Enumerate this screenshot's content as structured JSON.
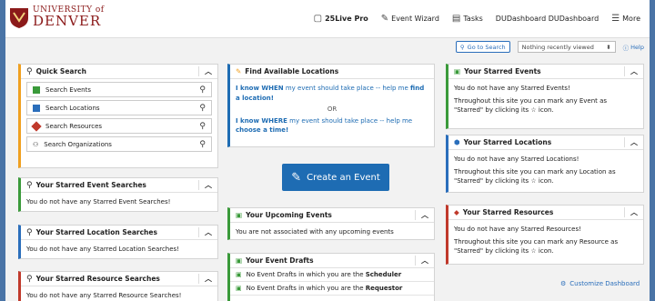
{
  "header": {
    "logo_line1": "UNIVERSITY of",
    "logo_line2": "DENVER",
    "nav": {
      "pro": "25Live Pro",
      "wizard": "Event Wizard",
      "tasks": "Tasks",
      "dashboard": "DUDashboard DUDashboard",
      "more": "More"
    }
  },
  "subbar": {
    "goto_label": "Go to Search",
    "recent_label": "Nothing recently viewed",
    "help_label": "Help"
  },
  "quick_search": {
    "title": "Quick Search",
    "items": [
      "Search Events",
      "Search Locations",
      "Search Resources",
      "Search Organizations"
    ]
  },
  "starred_event_searches": {
    "title": "Your Starred Event Searches",
    "body": "You do not have any Starred Event Searches!"
  },
  "starred_location_searches": {
    "title": "Your Starred Location Searches",
    "body": "You do not have any Starred Location Searches!"
  },
  "starred_resource_searches": {
    "title": "Your Starred Resource Searches",
    "body": "You do not have any Starred Resource Searches!"
  },
  "find_locations": {
    "title": "Find Available Locations",
    "line1_bold": "I know WHEN",
    "line1_mid": " my event should take place -- help me ",
    "line1_link": "find a location!",
    "or": "OR",
    "line2_bold": "I know WHERE",
    "line2_mid": " my event should take place -- help me ",
    "line2_link": "choose a time!"
  },
  "create_event": {
    "label": "Create an Event"
  },
  "upcoming": {
    "title": "Your Upcoming Events",
    "body": "You are not associated with any upcoming events"
  },
  "drafts": {
    "title": "Your Event Drafts",
    "row1_text": "No Event Drafts in which you are the ",
    "row1_bold": "Scheduler",
    "row2_text": "No Event Drafts in which you are the ",
    "row2_bold": "Requestor"
  },
  "starred_events": {
    "title": "Your Starred Events",
    "body1": "You do not have any Starred Events!",
    "body2": "Throughout this site you can mark any Event as \"Starred\" by clicking its ☆ icon."
  },
  "starred_locations": {
    "title": "Your Starred Locations",
    "body1": "You do not have any Starred Locations!",
    "body2": "Throughout this site you can mark any Location as \"Starred\" by clicking its ☆ icon."
  },
  "starred_resources": {
    "title": "Your Starred Resources",
    "body1": "You do not have any Starred Resources!",
    "body2": "Throughout this site you can mark any Resource as \"Starred\" by clicking its ☆ icon."
  },
  "customize": {
    "label": "Customize Dashboard"
  },
  "colors": {
    "accent": "#1e6cb3",
    "brand": "#8b1a1a",
    "green": "#3a9a3a",
    "orange": "#f0a020",
    "red": "#c0392b",
    "blue": "#2a6ebb"
  }
}
